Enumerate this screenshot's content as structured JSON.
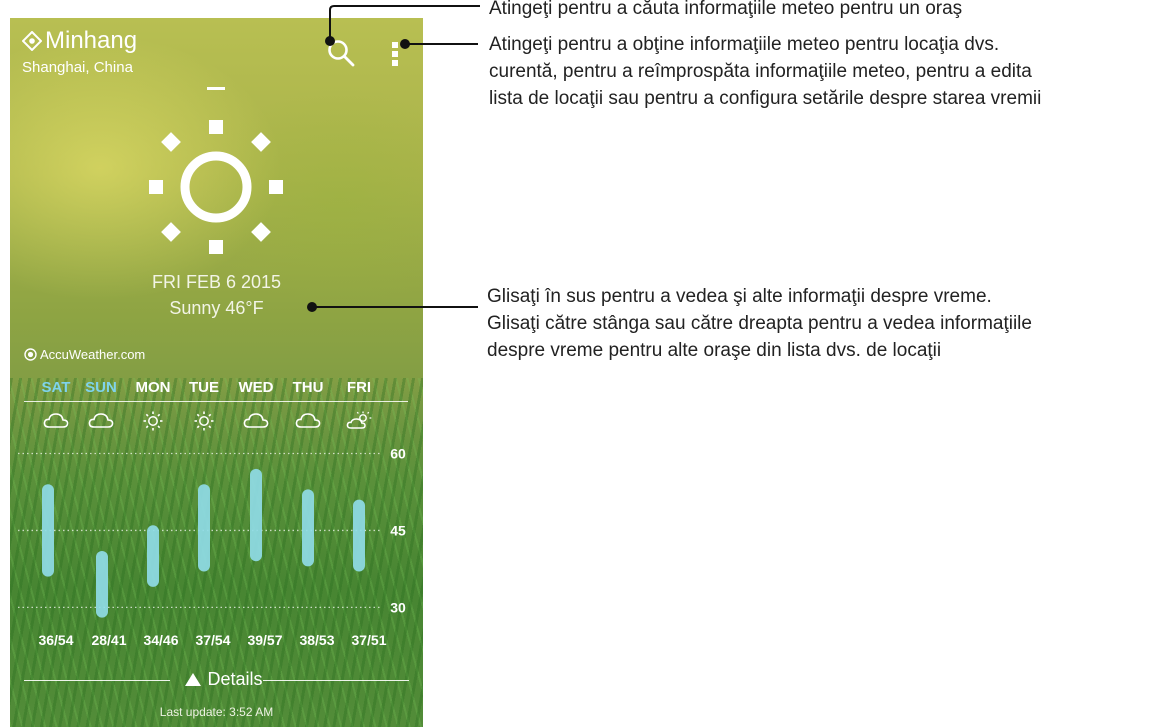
{
  "location": {
    "city": "Minhang",
    "region": "Shanghai, China"
  },
  "current": {
    "date": "FRI FEB 6 2015",
    "condition": "Sunny 46°F",
    "icon": "sun-icon"
  },
  "provider": "AccuWeather.com",
  "forecast": {
    "days": [
      {
        "label": "SAT",
        "icon": "cloud-icon",
        "low": 36,
        "high": 54,
        "range": "36/54",
        "highlight": true
      },
      {
        "label": "SUN",
        "icon": "cloud-icon",
        "low": 28,
        "high": 41,
        "range": "28/41",
        "highlight": true
      },
      {
        "label": "MON",
        "icon": "sun-icon",
        "low": 34,
        "high": 46,
        "range": "34/46",
        "highlight": false
      },
      {
        "label": "TUE",
        "icon": "sun-icon",
        "low": 37,
        "high": 54,
        "range": "37/54",
        "highlight": false
      },
      {
        "label": "WED",
        "icon": "cloud-icon",
        "low": 39,
        "high": 57,
        "range": "39/57",
        "highlight": false
      },
      {
        "label": "THU",
        "icon": "cloud-icon",
        "low": 38,
        "high": 53,
        "range": "38/53",
        "highlight": false
      },
      {
        "label": "FRI",
        "icon": "partly-sunny-icon",
        "low": 37,
        "high": 51,
        "range": "37/51",
        "highlight": false
      }
    ],
    "axis_ticks": [
      "60",
      "45",
      "30"
    ]
  },
  "chart_data": {
    "type": "bar",
    "categories": [
      "SAT",
      "SUN",
      "MON",
      "TUE",
      "WED",
      "THU",
      "FRI"
    ],
    "series": [
      {
        "name": "",
        "low": [
          36,
          28,
          34,
          37,
          39,
          38,
          37
        ],
        "high": [
          54,
          41,
          46,
          54,
          57,
          53,
          51
        ]
      }
    ],
    "yticks": [
      60,
      45,
      30
    ],
    "ylim": [
      25,
      64
    ],
    "grid": true,
    "bar_color": "#8fdbe6"
  },
  "details_label": "Details",
  "last_update": "Last update: 3:52 AM",
  "annotations": {
    "search": "Atingeţi pentru a căuta informaţiile meteo pentru un oraş",
    "menu": [
      "Atingeţi pentru a obţine informaţiile meteo pentru locaţia dvs.",
      "curentă, pentru a reîmprospăta informaţiile meteo, pentru a edita",
      "lista de locaţii sau pentru a configura setările despre starea vremii"
    ],
    "swipe": [
      "Glisaţi în sus pentru a vedea şi alte informaţii despre vreme.",
      "Glisaţi către stânga sau către dreapta pentru a vedea informaţiile",
      "despre vreme pentru alte oraşe din lista dvs. de locaţii"
    ]
  },
  "colors": {
    "highlight_day": "#7fd3ec",
    "bar": "#8fdbe6"
  }
}
